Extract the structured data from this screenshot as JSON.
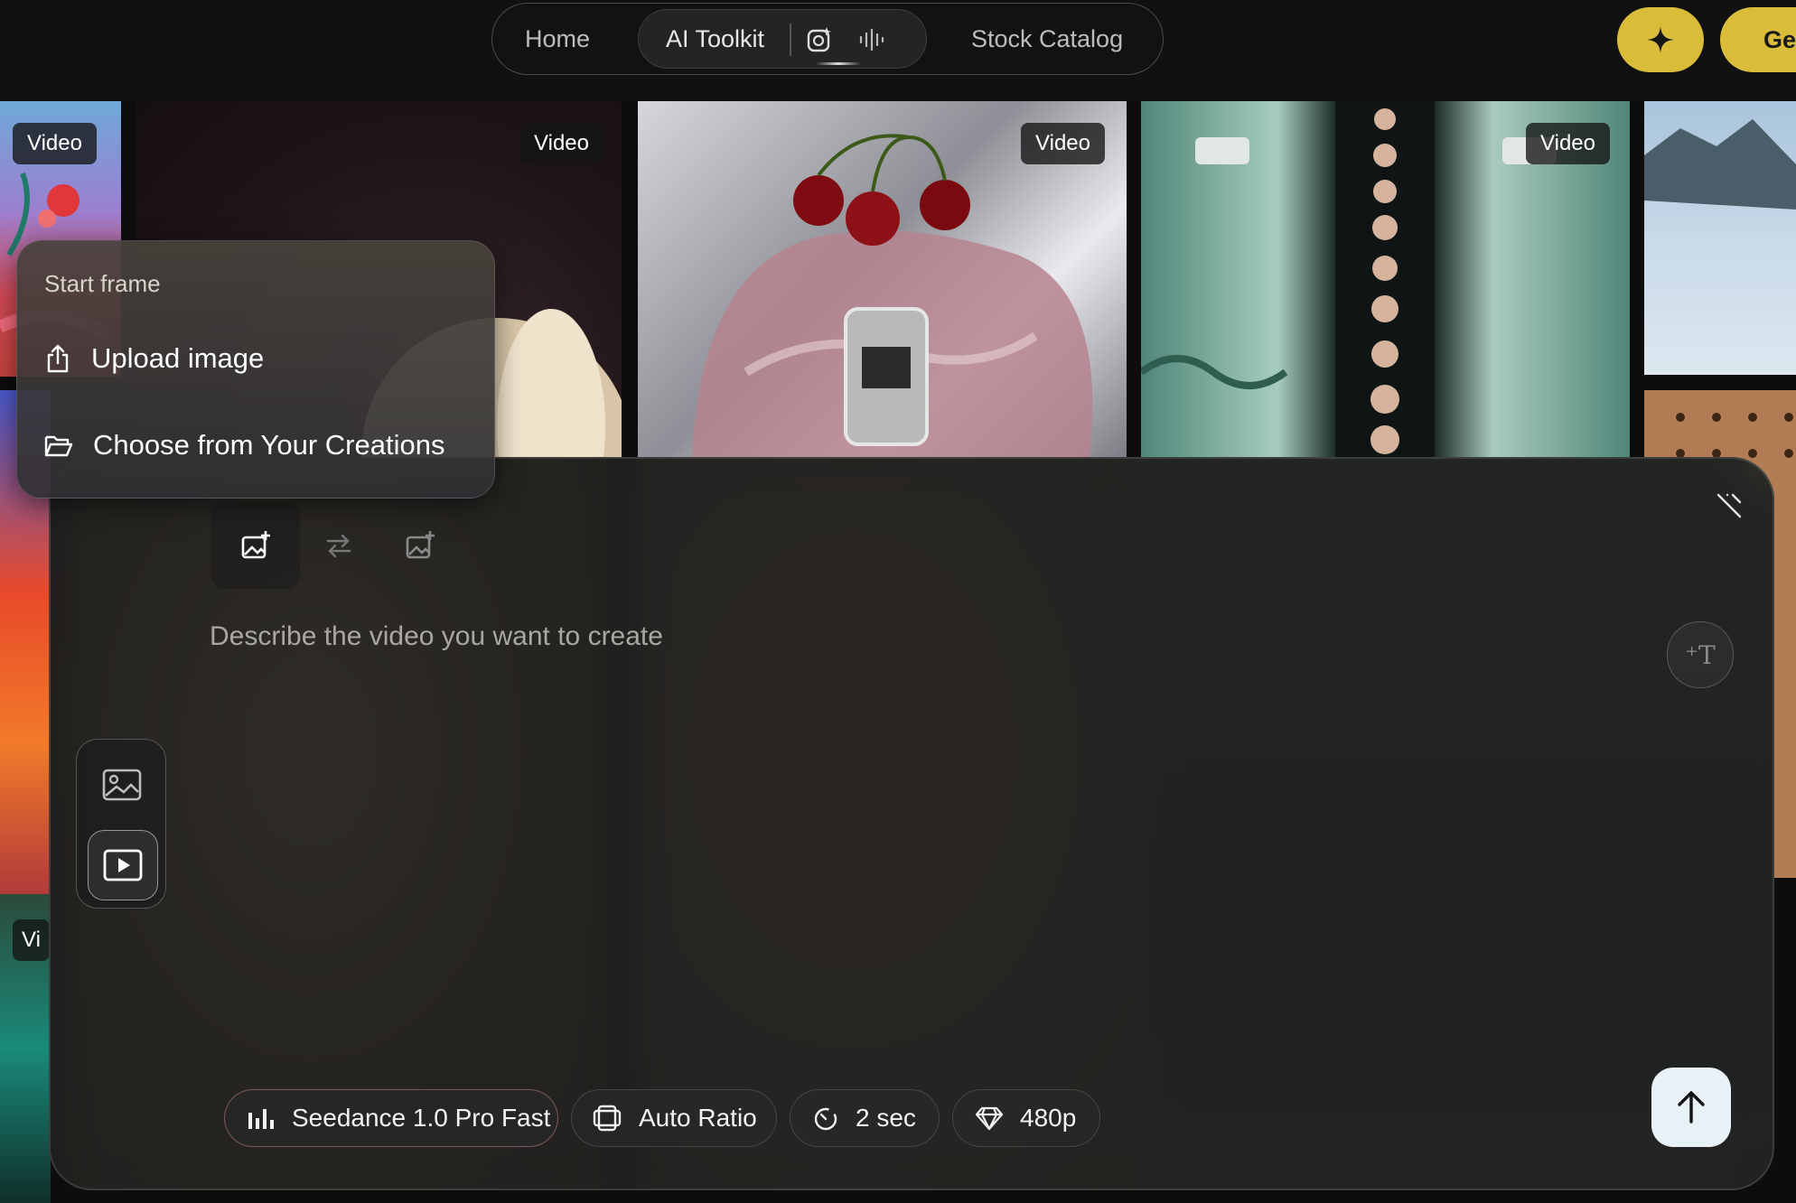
{
  "nav": {
    "home": "Home",
    "ai_toolkit": "AI Toolkit",
    "stock_catalog": "Stock Catalog",
    "toolkit_icons": [
      "image-sparkle-icon",
      "audio-wave-icon"
    ]
  },
  "header_actions": {
    "sparkle_icon": "sparkle-icon",
    "get_button_partial": "Ge",
    "accent_color": "#d9bd3a"
  },
  "gallery": {
    "badges": [
      "Video",
      "Video",
      "Video",
      "Video",
      "Vi"
    ]
  },
  "dropdown": {
    "title": "Start frame",
    "items": [
      {
        "label": "Upload image",
        "icon": "upload-icon"
      },
      {
        "label": "Choose from Your Creations",
        "icon": "folder-icon"
      }
    ]
  },
  "composer": {
    "frame_tabs": [
      "start-frame-image-icon",
      "swap-arrows-icon",
      "end-frame-image-icon"
    ],
    "prompt_placeholder": "Describe the video you want to create",
    "side_tools": [
      "image-mode-icon",
      "video-mode-icon"
    ],
    "chips": {
      "model": "Seedance 1.0 Pro Fast",
      "ratio": "Auto Ratio",
      "duration": "2 sec",
      "resolution": "480p"
    },
    "send_icon": "arrow-up-icon",
    "send_bg": "#e8f1f6"
  }
}
